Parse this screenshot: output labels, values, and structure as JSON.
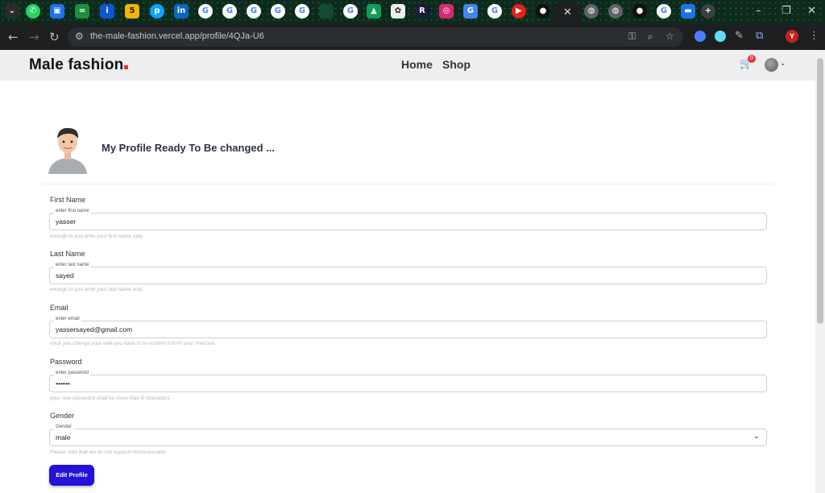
{
  "browser": {
    "url": "the-male-fashion.vercel.app/profile/4QJa-U6",
    "profile_initial": "Y",
    "tab_icons": [
      "whatsapp-icon",
      "app-icon",
      "code-icon",
      "app-icon",
      "app-icon",
      "app-icon",
      "linkedin-icon",
      "google-icon",
      "google-icon",
      "google-icon",
      "google-icon",
      "google-icon",
      "app-icon",
      "google-icon",
      "drive-icon",
      "chatgpt-icon",
      "replit-icon",
      "instagram-icon",
      "translate-icon",
      "google-icon",
      "youtube-icon",
      "github-icon"
    ],
    "new_tab_glyph": "+"
  },
  "site": {
    "logo": "Male fashion",
    "nav": {
      "home": "Home",
      "shop": "Shop"
    },
    "cart_count": "0"
  },
  "profile": {
    "heading": "My Profile Ready To Be changed ...",
    "fields": [
      {
        "label": "First Name",
        "legend": "enter first name",
        "value": "yasser",
        "hint": "enough to just write your first name only."
      },
      {
        "label": "Last Name",
        "legend": "enter last name",
        "value": "sayed",
        "hint": "enough to just write your last name only."
      },
      {
        "label": "Email",
        "legend": "enter email",
        "value": "yassersayed@gmail.com",
        "hint": "once you change your mail you have to re-confirm it form your mail box"
      },
      {
        "label": "Password",
        "legend": "enter password",
        "value": "••••••",
        "hint": "your new password shall be more than 6 characters"
      },
      {
        "label": "Gender",
        "legend": "Gender",
        "value": "male",
        "hint": "Please note that we do not support homosexuality"
      }
    ],
    "submit_label": "Edit Profile"
  },
  "colors": {
    "accent_button": "#2412d6",
    "logo_dot": "#e53637",
    "header_bg": "#eceef0"
  }
}
